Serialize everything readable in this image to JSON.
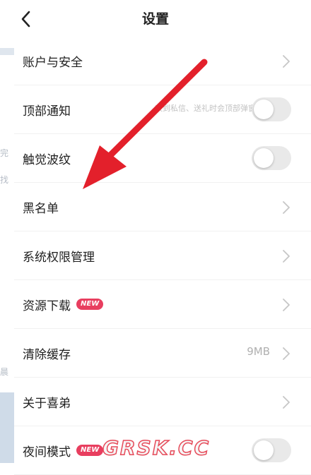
{
  "header": {
    "title": "设置",
    "back_icon": "chevron-left-icon"
  },
  "colors": {
    "accent_badge": "#e83e5f",
    "arrow": "#e3202b",
    "toggle_off": "#e9e9e9"
  },
  "settings": [
    {
      "label": "账户与安全",
      "control": "chevron"
    },
    {
      "label": "顶部通知",
      "hint": "收到私信、送礼时会顶部弹窗",
      "control": "toggle",
      "on": false
    },
    {
      "label": "触觉波纹",
      "control": "toggle",
      "on": false
    },
    {
      "label": "黑名单",
      "control": "chevron"
    },
    {
      "label": "系统权限管理",
      "control": "chevron"
    },
    {
      "label": "资源下载",
      "badge": "NEW",
      "control": "chevron"
    },
    {
      "label": "清除缓存",
      "value": "9MB",
      "control": "chevron"
    },
    {
      "label": "关于喜弟",
      "control": "chevron"
    },
    {
      "label": "夜间模式",
      "badge": "NEW",
      "control": "toggle",
      "on": false
    }
  ],
  "background_ghost": {
    "texts": [
      "完",
      "找",
      "晨"
    ]
  },
  "watermark": "GRSK.CC"
}
